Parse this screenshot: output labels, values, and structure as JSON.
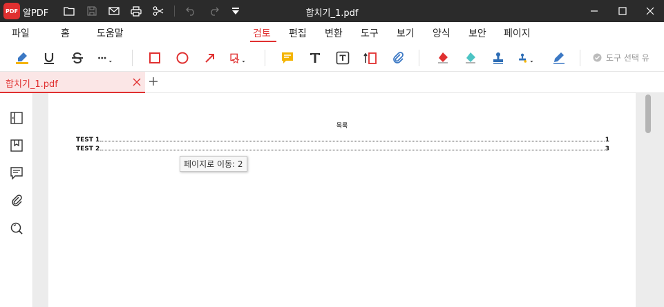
{
  "app": {
    "name": "알PDF",
    "logo_text": "PDF",
    "window_title": "합치기_1.pdf"
  },
  "menu": {
    "items": [
      {
        "label": "파일"
      },
      {
        "label": "홈"
      },
      {
        "label": "도움말"
      },
      {
        "label": "검토",
        "active": true
      },
      {
        "label": "편집"
      },
      {
        "label": "변환"
      },
      {
        "label": "도구"
      },
      {
        "label": "보기"
      },
      {
        "label": "양식"
      },
      {
        "label": "보안"
      },
      {
        "label": "페이지"
      }
    ]
  },
  "toolbar": {
    "keep_tool_label": "도구 선택 유"
  },
  "tabs": {
    "active_tab_label": "합치기_1.pdf"
  },
  "document": {
    "toc_title": "목록",
    "entries": [
      {
        "title": "TEST 1",
        "page": "1"
      },
      {
        "title": "TEST 2",
        "page": "3"
      }
    ],
    "tooltip": "페이지로 이동: 2"
  },
  "colors": {
    "accent": "#e03030",
    "titlebar": "#2b2b2b",
    "highlight": "#f4b400",
    "marker": "#4cc4c4",
    "stamp": "#2d6db5"
  }
}
